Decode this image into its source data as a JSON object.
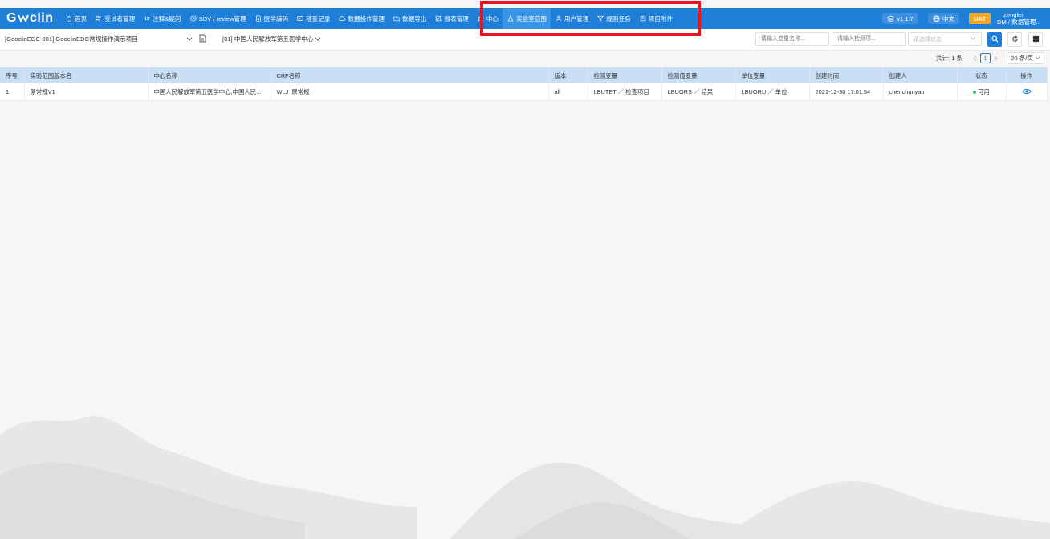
{
  "brand": {
    "logo_text_left": "G",
    "logo_text_right": "clin"
  },
  "nav": [
    {
      "label": "首页",
      "icon": "home-icon"
    },
    {
      "label": "受试者管理",
      "icon": "user-group-icon"
    },
    {
      "label": "注释&疑问",
      "icon": "annotation-icon"
    },
    {
      "label": "SDV / review管理",
      "icon": "clock-icon"
    },
    {
      "label": "医学编码",
      "icon": "document-icon"
    },
    {
      "label": "稽查记录",
      "icon": "record-icon"
    },
    {
      "label": "数据操作管理",
      "icon": "cloud-icon"
    },
    {
      "label": "数据导出",
      "icon": "folder-icon"
    },
    {
      "label": "报表管理",
      "icon": "check-square-icon"
    },
    {
      "label": "中心",
      "icon": "bank-icon"
    },
    {
      "label": "实验室范围",
      "icon": "flask-icon",
      "active": true
    },
    {
      "label": "用户管理",
      "icon": "person-icon"
    },
    {
      "label": "规则任务",
      "icon": "filter-icon"
    },
    {
      "label": "项目附件",
      "icon": "attachment-icon"
    }
  ],
  "right": {
    "version": "v1.1.7",
    "language": "中文",
    "env": "UAT",
    "user_name": "zenglei",
    "user_role": "DM / 数据管理..."
  },
  "toolbar": {
    "project": "[GooclinEDC-001]  GooclinEDC常规操作演示项目",
    "site": "[01]  中国人民解放军第五医学中心",
    "search_var_placeholder": "请输入变量名称...",
    "search_test_placeholder": "请输入检测项...",
    "status_placeholder": "请选择状态"
  },
  "pager": {
    "total": "共计: 1 条",
    "page": "1",
    "size": "20 条/页"
  },
  "table": {
    "headers": [
      "序号",
      "实验范围版本名",
      "中心名称",
      "CRF名称",
      "版本",
      "检测变量",
      "检测值变量",
      "单位变量",
      "创建时间",
      "创建人",
      "状态",
      "操作"
    ],
    "rows": [
      [
        "1",
        "尿常规V1",
        "中国人民解放军第五医学中心,中国人民...",
        "WLJ_尿常规",
        "all",
        "LBUTET ／ 检查项目",
        "LBUORS ／ 结果",
        "LBUORU ／ 单位",
        "2021-12-30 17:01:54",
        "chenchunyan",
        "可用",
        ""
      ]
    ]
  }
}
